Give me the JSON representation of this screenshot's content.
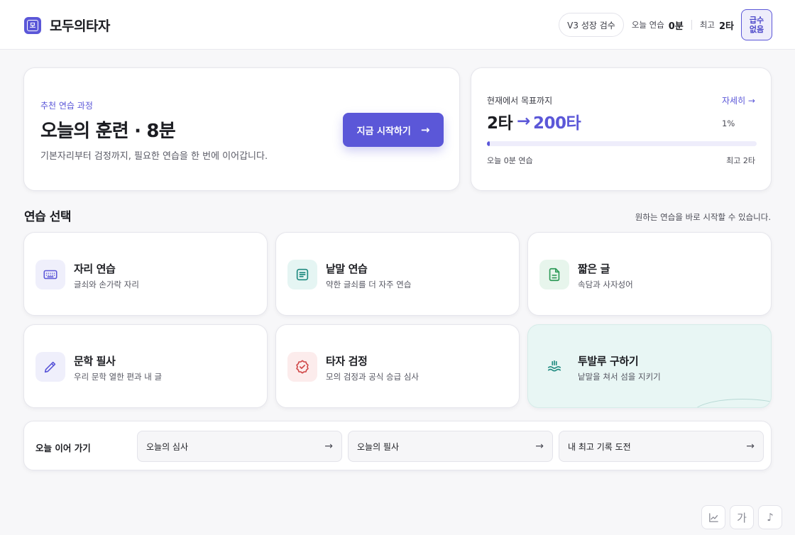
{
  "header": {
    "logo_glyph": "모",
    "brand": "모두의타자",
    "version": "V3 성장 검수",
    "today_label": "오늘 연습",
    "today_value": "0분",
    "best_label": "최고",
    "best_value": "2타",
    "grade_badge": "급수\n없음"
  },
  "hero": {
    "eyebrow": "추천 연습 과정",
    "title": "오늘의 훈련 · 8분",
    "description": "기본자리부터 검정까지, 필요한 연습을 한 번에 이어갑니다.",
    "start_label": "지금 시작하기",
    "start_arrow": "→"
  },
  "goal": {
    "label": "현재에서 목표까지",
    "detail_link": "자세히 →",
    "current": "2타",
    "arrow": "→",
    "target": "200타",
    "percent_label": "1%",
    "progress_fraction": 0.01,
    "left_caption": "오늘 0분 연습",
    "right_caption": "최고 2타"
  },
  "section": {
    "title": "연습 선택",
    "hint": "원하는 연습을 바로 시작할 수 있습니다."
  },
  "tiles": [
    {
      "title": "자리 연습",
      "desc": "글쇠와 손가락 자리",
      "icon": "keyboard-icon",
      "bg": "#efeffb",
      "fg": "#5b57d8"
    },
    {
      "title": "낱말 연습",
      "desc": "약한 글쇠를 더 자주 연습",
      "icon": "text-lines-icon",
      "bg": "#e5f5f3",
      "fg": "#1f8a80"
    },
    {
      "title": "짧은 글",
      "desc": "속담과 사자성어",
      "icon": "document-icon",
      "bg": "#e7f5ec",
      "fg": "#2e9a58"
    },
    {
      "title": "문학 필사",
      "desc": "우리 문학 열한 편과 내 글",
      "icon": "pencil-icon",
      "bg": "#efeffb",
      "fg": "#5b57d8"
    },
    {
      "title": "타자 검정",
      "desc": "모의 검정과 공식 승급 심사",
      "icon": "badge-check-icon",
      "bg": "#fcecec",
      "fg": "#d04848"
    },
    {
      "title": "투발루 구하기",
      "desc": "낱말을 쳐서 섬을 지키기",
      "icon": "waves-icon",
      "bg": "#e8f6f4",
      "fg": "#1f8a80"
    }
  ],
  "continue_bar": {
    "label": "오늘 이어 가기",
    "items": [
      {
        "label": "오늘의 심사",
        "arrow": "→"
      },
      {
        "label": "오늘의 필사",
        "arrow": "→"
      },
      {
        "label": "내 최고 기록 도전",
        "arrow": "→"
      }
    ]
  },
  "tools": {
    "font_glyph": "가",
    "music_glyph": "♪"
  },
  "colors": {
    "accent": "#5b57d8",
    "background": "#f7f7f9",
    "highlight_tile": "#e8f6f4"
  }
}
